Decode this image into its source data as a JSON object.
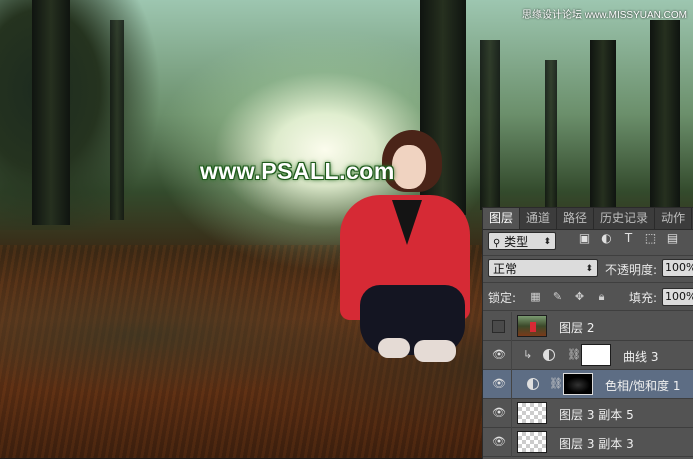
{
  "photo": {
    "watermark": "www.PSALL.com",
    "site_credit": "思缘设计论坛 www.MISSYUAN.COM"
  },
  "panel": {
    "tabs": [
      {
        "label": "图层",
        "active": true
      },
      {
        "label": "通道",
        "active": false
      },
      {
        "label": "路径",
        "active": false
      },
      {
        "label": "历史记录",
        "active": false
      },
      {
        "label": "动作",
        "active": false
      }
    ],
    "filter": {
      "label": "类型",
      "icon": "search-icon"
    },
    "blend_mode": "正常",
    "opacity": {
      "label": "不透明度:",
      "value": "100%"
    },
    "lock": {
      "label": "锁定:"
    },
    "fill": {
      "label": "填充:",
      "value": "100%"
    },
    "layers": [
      {
        "name": "图层 2",
        "visible": false,
        "thumb": "photo",
        "selected": false
      },
      {
        "name": "曲线 3",
        "visible": true,
        "thumb": "white",
        "adjustment": true,
        "clipped": true,
        "selected": false
      },
      {
        "name": "色相/饱和度 1",
        "visible": true,
        "thumb": "black-mask",
        "adjustment": true,
        "clipped": false,
        "selected": true
      },
      {
        "name": "图层 3 副本 5",
        "visible": true,
        "thumb": "checker",
        "selected": false
      },
      {
        "name": "图层 3 副本 3",
        "visible": true,
        "thumb": "checker",
        "selected": false
      }
    ]
  }
}
